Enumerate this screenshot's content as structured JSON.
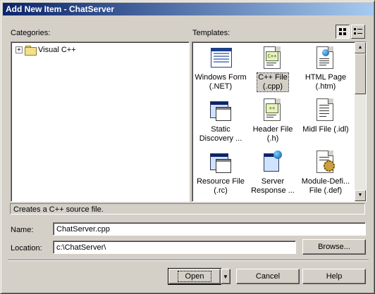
{
  "window": {
    "title": "Add New Item - ChatServer"
  },
  "categories": {
    "label": "Categories:",
    "items": [
      {
        "label": "Visual C++",
        "expander": "+",
        "icon": "folder-icon"
      }
    ]
  },
  "templates": {
    "label": "Templates:",
    "view_buttons": [
      {
        "name": "large-icons-view",
        "icon": "large-icons-view-icon",
        "pressed": true
      },
      {
        "name": "small-icons-view",
        "icon": "list-view-icon",
        "pressed": false
      }
    ],
    "items": [
      {
        "line1": "Windows Form",
        "line2": "(.NET)",
        "icon": "windows-form-icon"
      },
      {
        "line1": "C++ File",
        "line2": "(.cpp)",
        "icon": "cpp-file-icon",
        "selected": true
      },
      {
        "line1": "HTML Page",
        "line2": "(.htm)",
        "icon": "html-page-icon"
      },
      {
        "line1": "Static",
        "line2": "Discovery ...",
        "icon": "static-discovery-icon"
      },
      {
        "line1": "Header File",
        "line2": "(.h)",
        "icon": "header-file-icon"
      },
      {
        "line1": "Midl File (.idl)",
        "line2": "",
        "icon": "midl-file-icon"
      },
      {
        "line1": "Resource File",
        "line2": "(.rc)",
        "icon": "resource-file-icon"
      },
      {
        "line1": "Server",
        "line2": "Response ...",
        "icon": "server-response-icon"
      },
      {
        "line1": "Module-Defi...",
        "line2": "File (.def)",
        "icon": "module-def-icon"
      }
    ]
  },
  "description": "Creates a C++ source file.",
  "name_field": {
    "label": "Name:",
    "value": "ChatServer.cpp"
  },
  "location_field": {
    "label": "Location:",
    "value": "c:\\ChatServer\\"
  },
  "buttons": {
    "browse": "Browse...",
    "open": "Open",
    "cancel": "Cancel",
    "help": "Help"
  }
}
